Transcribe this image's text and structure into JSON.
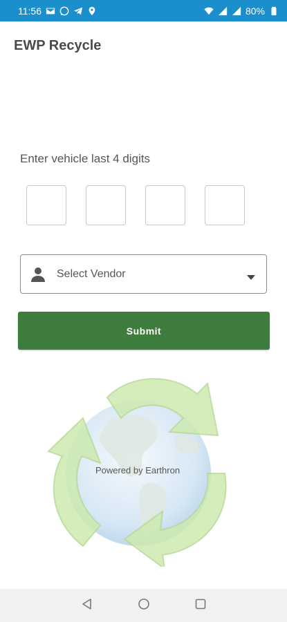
{
  "status_bar": {
    "time": "11:56",
    "battery": "80%",
    "left_icons": [
      "mail-icon",
      "whatsapp-icon",
      "telegram-icon",
      "location-icon"
    ],
    "right_icons": [
      "wifi-icon",
      "signal-icon",
      "signal-icon",
      "battery-icon"
    ]
  },
  "app": {
    "title": "EWP Recycle"
  },
  "form": {
    "prompt": "Enter vehicle last 4 digits",
    "digit_count": 4,
    "vendor_placeholder": "Select Vendor",
    "submit_label": "Submit"
  },
  "footer": {
    "powered_by": "Powered by Earthron"
  },
  "colors": {
    "status_bar": "#1b8fcc",
    "submit_button": "#3f7d3f",
    "nav_bar": "#f1f1f1"
  },
  "nav": {
    "icons": [
      "back-icon",
      "home-icon",
      "recents-icon"
    ]
  }
}
